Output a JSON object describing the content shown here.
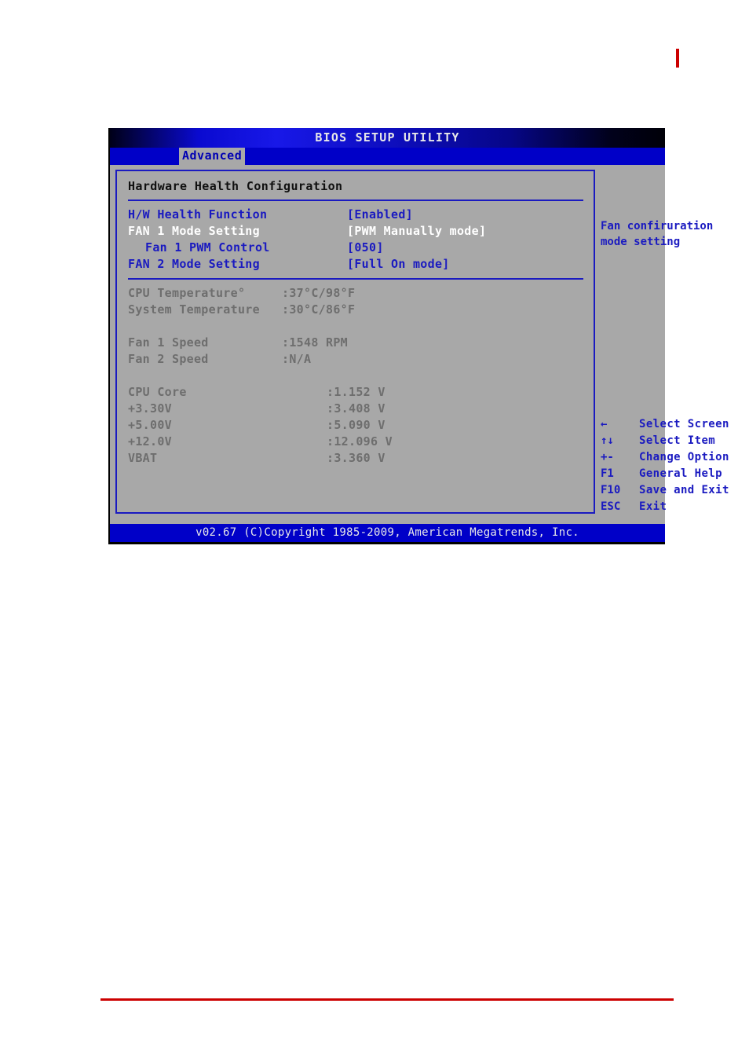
{
  "window": {
    "title": "BIOS SETUP UTILITY",
    "active_tab": "Advanced",
    "footer": "v02.67 (C)Copyright 1985-2009, American Megatrends, Inc."
  },
  "main": {
    "section_title": "Hardware Health Configuration",
    "settings": [
      {
        "label": "H/W Health Function",
        "value": "[Enabled]",
        "state": "normal",
        "indent": false
      },
      {
        "label": "FAN 1 Mode Setting",
        "value": "[PWM Manually mode]",
        "state": "selected",
        "indent": false
      },
      {
        "label": "Fan 1 PWM Control",
        "value": "[050]",
        "state": "normal",
        "indent": true
      },
      {
        "label": "FAN 2 Mode Setting",
        "value": "[Full On mode]",
        "state": "normal",
        "indent": false
      }
    ],
    "temperatures": [
      {
        "label": "CPU Temperature°",
        "value": ":37°C/98°F"
      },
      {
        "label": "System Temperature",
        "value": ":30°C/86°F"
      }
    ],
    "fans": [
      {
        "label": "Fan 1 Speed",
        "value": ":1548 RPM"
      },
      {
        "label": "Fan 2 Speed",
        "value": ":N/A"
      }
    ],
    "voltages": [
      {
        "label": "CPU Core",
        "value": ":1.152 V"
      },
      {
        "label": "+3.30V",
        "value": ":3.408 V"
      },
      {
        "label": "+5.00V",
        "value": ":5.090 V"
      },
      {
        "label": "+12.0V",
        "value": ":12.096 V"
      },
      {
        "label": "VBAT",
        "value": ":3.360 V"
      }
    ]
  },
  "help": {
    "text": "Fan confiruration\nmode setting",
    "keys": [
      {
        "key": "←",
        "desc": "Select Screen"
      },
      {
        "key": "↑↓",
        "desc": "Select Item"
      },
      {
        "key": "+-",
        "desc": "Change Option"
      },
      {
        "key": "F1",
        "desc": "General Help"
      },
      {
        "key": "F10",
        "desc": "Save and Exit"
      },
      {
        "key": "ESC",
        "desc": "Exit"
      }
    ]
  },
  "colors": {
    "accent_blue": "#1a1ac0",
    "bar_blue": "#0000c8",
    "panel_gray": "#a8a8a8",
    "selected_white": "#ffffff",
    "disabled_gray": "#6e6e6e",
    "page_red": "#cc0000"
  }
}
